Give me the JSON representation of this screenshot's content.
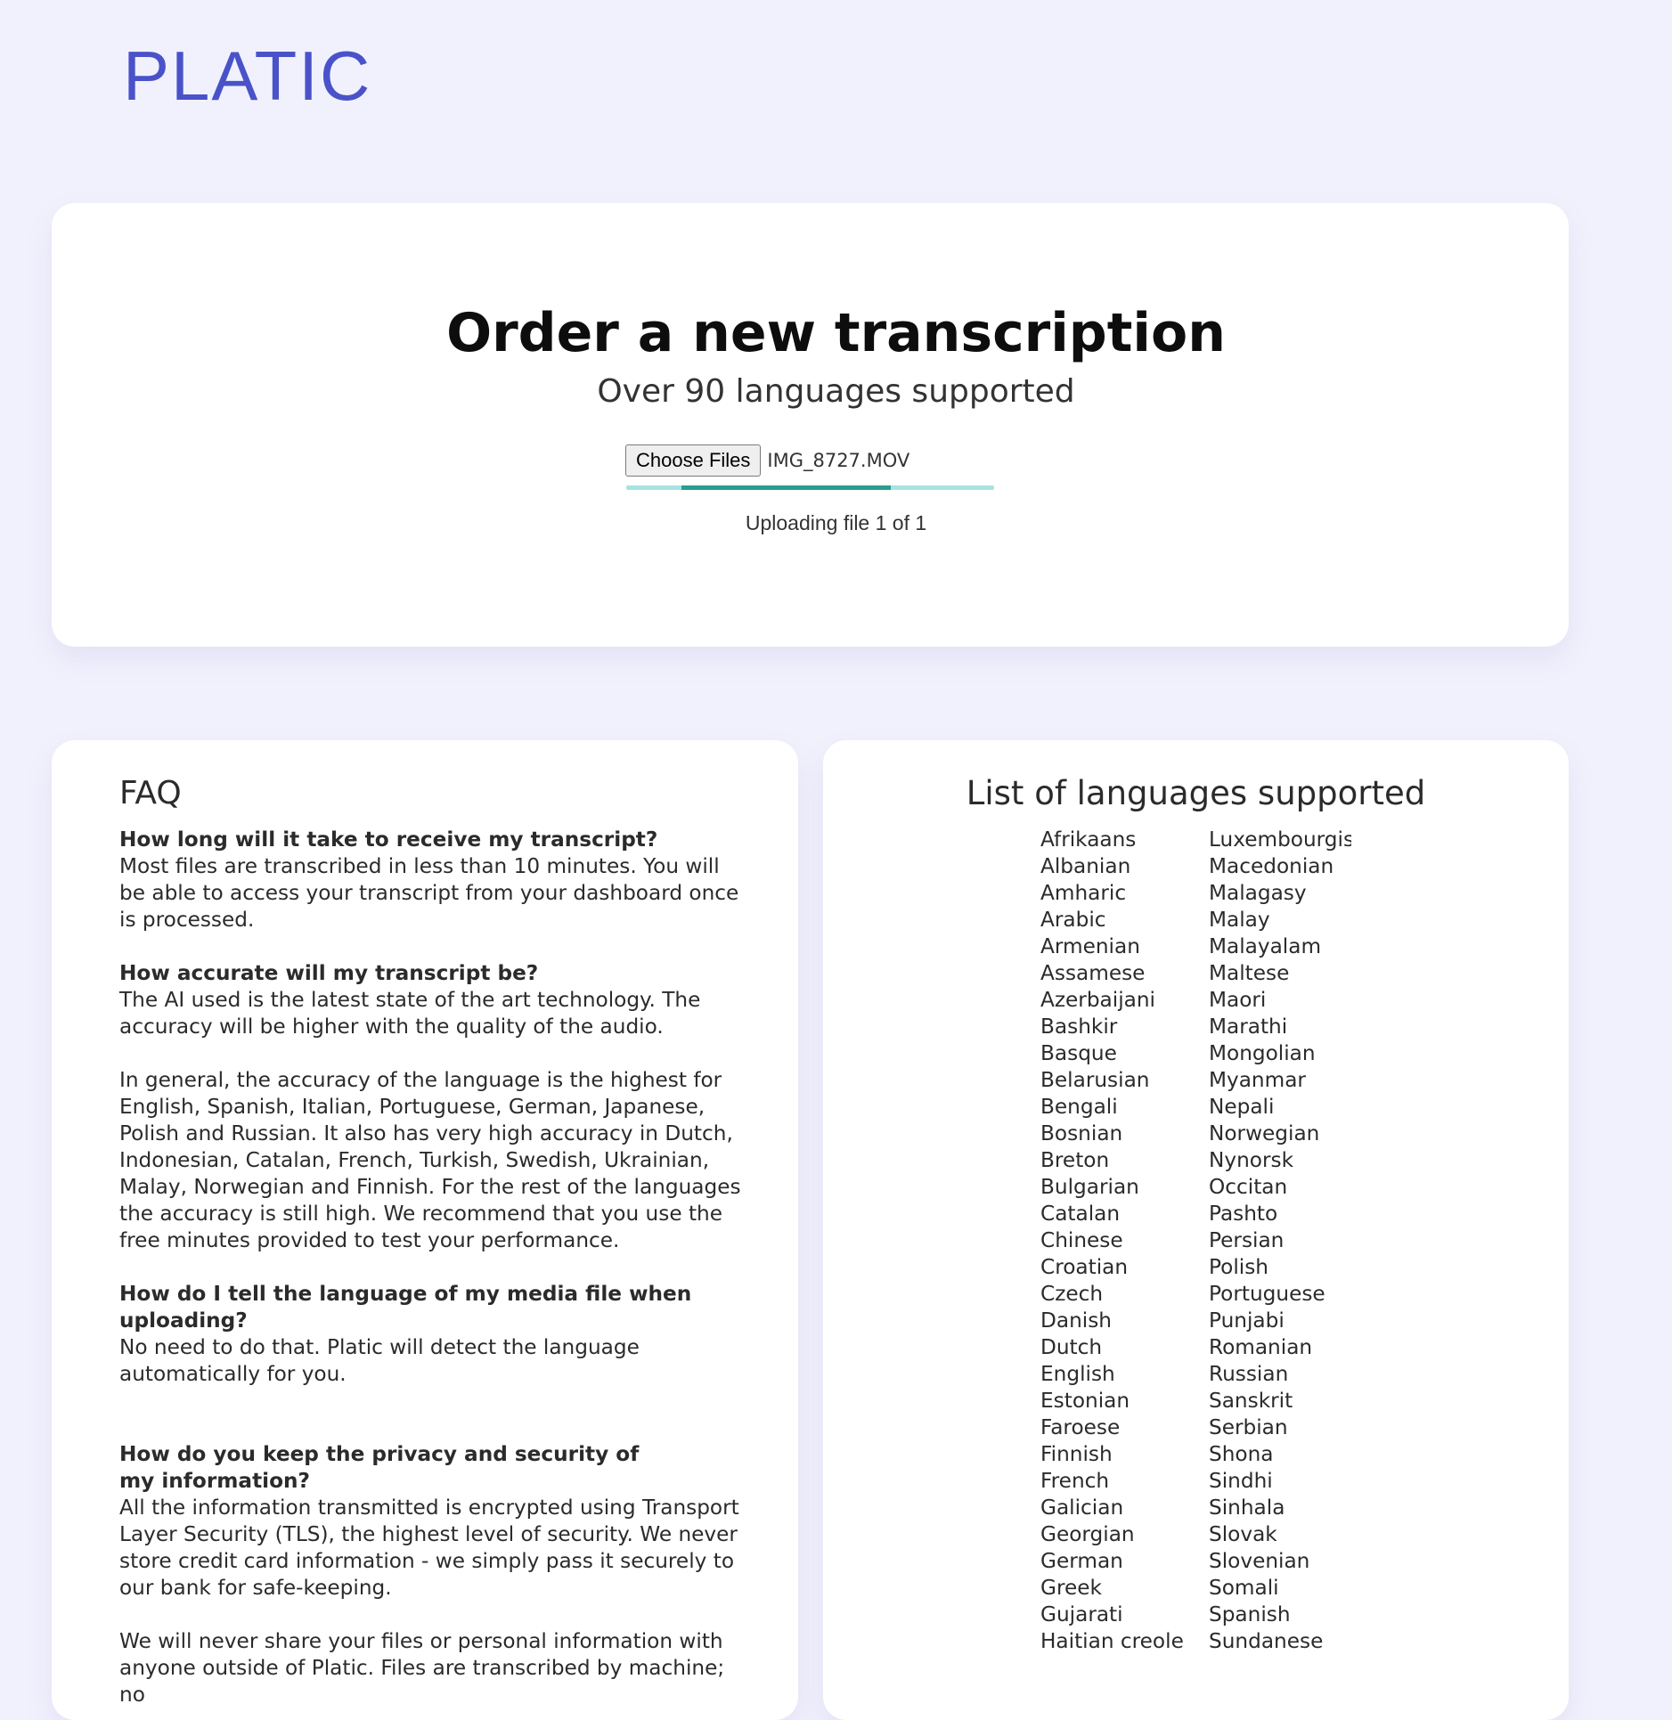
{
  "brand": {
    "logo_text": "PLATIC"
  },
  "order": {
    "title": "Order a new transcription",
    "subtitle": "Over 90 languages supported",
    "choose_files_label": "Choose Files",
    "file_name": "IMG_8727.MOV",
    "upload_status": "Uploading file 1 of 1",
    "upload_progress": 0.67
  },
  "faq": {
    "heading": "FAQ",
    "items": [
      {
        "question": "How long will it take to receive my transcript?",
        "answer": "Most files are transcribed in less than 10 minutes. You will be able to access your transcript from your dashboard once is processed."
      },
      {
        "question": "How accurate will my transcript be?",
        "answer": "The AI used is the latest state of the art technology. The accuracy will be higher with the quality of the audio.",
        "answer_extra": "In general, the accuracy of the language is the highest for English, Spanish, Italian, Portuguese, German, Japanese, Polish and Russian. It also has very high accuracy in Dutch, Indonesian, Catalan, French, Turkish, Swedish, Ukrainian, Malay, Norwegian and Finnish. For the rest of the languages the accuracy is still high. We recommend that you use the free minutes provided to test your performance."
      },
      {
        "question": "How do I tell the language of my media file when uploading?",
        "answer": "No need to do that. Platic will detect the language automatically for you."
      },
      {
        "question": "How do you keep the privacy and security of my information?",
        "answer": "All the information transmitted is encrypted using Transport Layer Security (TLS), the highest level of security. We never store credit card information - we simply pass it securely to our bank for safe-keeping.",
        "answer_extra": "We will never share your files or personal information with anyone outside of Platic. Files are transcribed by machine; no"
      }
    ]
  },
  "languages": {
    "heading": "List of languages supported",
    "column_1": [
      "Afrikaans",
      "Albanian",
      "Amharic",
      "Arabic",
      "Armenian",
      "Assamese",
      "Azerbaijani",
      "Bashkir",
      "Basque",
      "Belarusian",
      "Bengali",
      "Bosnian",
      "Breton",
      "Bulgarian",
      "Catalan",
      "Chinese",
      "Croatian",
      "Czech",
      "Danish",
      "Dutch",
      "English",
      "Estonian",
      "Faroese",
      "Finnish",
      "French",
      "Galician",
      "Georgian",
      "German",
      "Greek",
      "Gujarati",
      "Haitian creole"
    ],
    "column_2": [
      "Luxembourgish",
      "Macedonian",
      "Malagasy",
      "Malay",
      "Malayalam",
      "Maltese",
      "Maori",
      "Marathi",
      "Mongolian",
      "Myanmar",
      "Nepali",
      "Norwegian",
      "Nynorsk",
      "Occitan",
      "Pashto",
      "Persian",
      "Polish",
      "Portuguese",
      "Punjabi",
      "Romanian",
      "Russian",
      "Sanskrit",
      "Serbian",
      "Shona",
      "Sindhi",
      "Sinhala",
      "Slovak",
      "Slovenian",
      "Somali",
      "Spanish",
      "Sundanese"
    ]
  },
  "colors": {
    "background": "#f1f1fd",
    "logo": "#4a52c9",
    "progress_track": "#a6e3e2",
    "progress_fill": "#2a9d8f"
  }
}
